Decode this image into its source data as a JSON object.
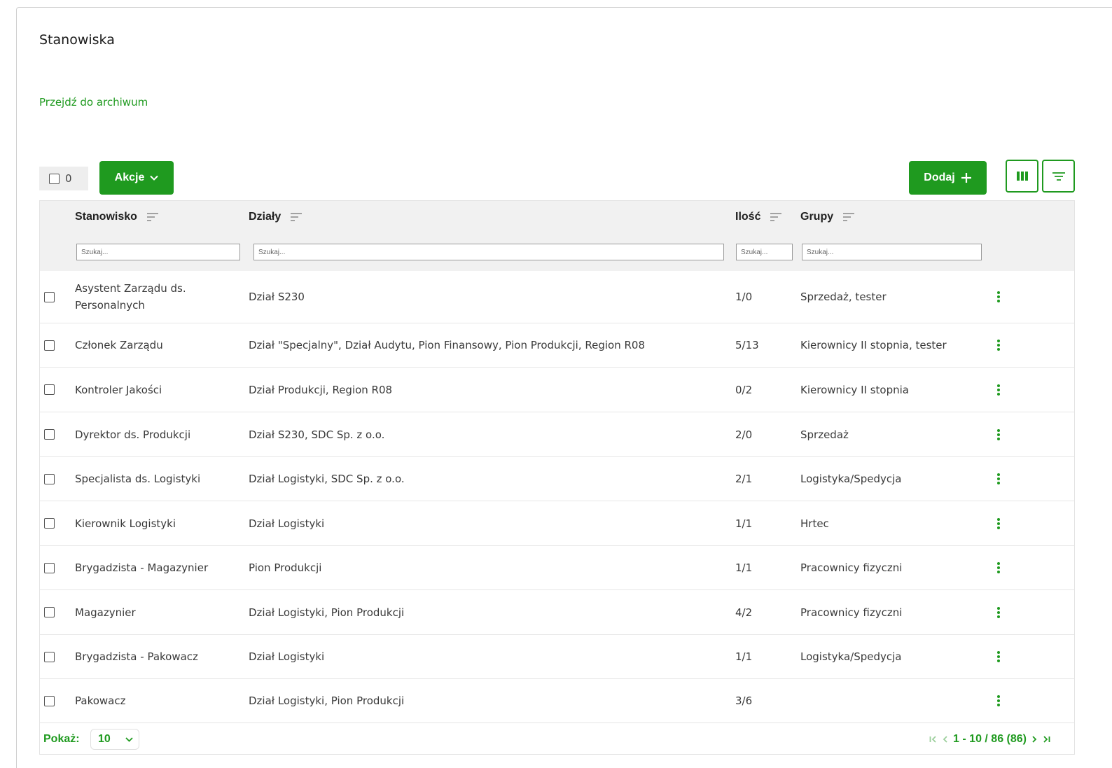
{
  "page": {
    "title": "Stanowiska",
    "archive_link": "Przejdź do archiwum"
  },
  "toolbar": {
    "selected_count": "0",
    "actions_label": "Akcje",
    "add_label": "Dodaj"
  },
  "table": {
    "columns": [
      "Stanowisko",
      "Działy",
      "Ilość",
      "Grupy"
    ],
    "search_placeholder": "Szukaj...",
    "rows": [
      {
        "name": "Asystent Zarządu ds. Personalnych",
        "dept": "Dział S230",
        "qty": "1/0",
        "groups": "Sprzedaż, tester"
      },
      {
        "name": "Członek Zarządu",
        "dept": "Dział \"Specjalny\", Dział Audytu, Pion Finansowy, Pion Produkcji, Region R08",
        "qty": "5/13",
        "groups": "Kierownicy II stopnia, tester"
      },
      {
        "name": "Kontroler Jakości",
        "dept": "Dział Produkcji, Region R08",
        "qty": "0/2",
        "groups": "Kierownicy II stopnia"
      },
      {
        "name": "Dyrektor ds. Produkcji",
        "dept": "Dział S230, SDC Sp. z o.o.",
        "qty": "2/0",
        "groups": "Sprzedaż"
      },
      {
        "name": "Specjalista ds. Logistyki",
        "dept": "Dział Logistyki, SDC Sp. z o.o.",
        "qty": "2/1",
        "groups": "Logistyka/Spedycja"
      },
      {
        "name": "Kierownik Logistyki",
        "dept": "Dział Logistyki",
        "qty": "1/1",
        "groups": "Hrtec"
      },
      {
        "name": "Brygadzista - Magazynier",
        "dept": "Pion Produkcji",
        "qty": "1/1",
        "groups": "Pracownicy fizyczni"
      },
      {
        "name": "Magazynier",
        "dept": "Dział Logistyki, Pion Produkcji",
        "qty": "4/2",
        "groups": "Pracownicy fizyczni"
      },
      {
        "name": "Brygadzista - Pakowacz",
        "dept": "Dział Logistyki",
        "qty": "1/1",
        "groups": "Logistyka/Spedycja"
      },
      {
        "name": "Pakowacz",
        "dept": "Dział Logistyki, Pion Produkcji",
        "qty": "3/6",
        "groups": ""
      }
    ]
  },
  "footer": {
    "show_label": "Pokaż:",
    "page_size": "10",
    "range_text": "1 - 10 / 86 (86)"
  },
  "colors": {
    "accent": "#1f9a1f",
    "header_bg": "#f1f1f1"
  },
  "icons": [
    "chevron-down-icon",
    "plus-icon",
    "columns-icon",
    "filter-icon",
    "sort-icon",
    "kebab-menu-icon",
    "first-page-icon",
    "prev-page-icon",
    "next-page-icon",
    "last-page-icon"
  ]
}
